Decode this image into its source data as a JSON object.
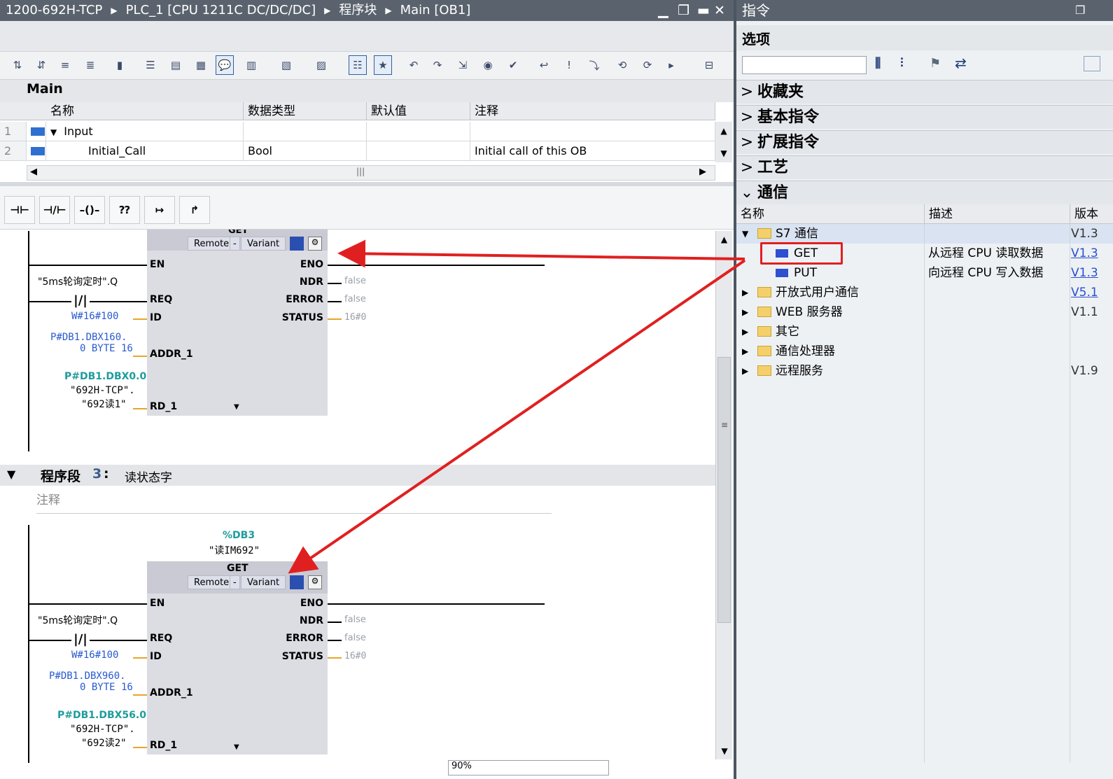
{
  "editor": {
    "breadcrumb": [
      "1200-692H-TCP",
      "PLC_1 [CPU 1211C DC/DC/DC]",
      "程序块",
      "Main [OB1]"
    ],
    "window_controls": [
      "minimize-icon",
      "restore-icon",
      "maximize-icon",
      "close-icon"
    ],
    "toolbar_icons": [
      "insert-network-icon",
      "delete-network-icon",
      "insert-row-icon",
      "add-row-icon",
      "display-favorites-icon",
      "open-all-networks-icon",
      "close-all-networks-icon",
      "show-absolute-operands-icon",
      "comments-toggle-icon",
      "operand-display-icon",
      "symbol-info-icon",
      "symbol-assign-icon",
      "monitor-table-icon",
      "favorites-icon",
      "jump-prev-icon",
      "jump-next-icon",
      "goto-icon",
      "watch-icon",
      "compile-icon",
      "call-icon",
      "breakpoint-icon",
      "step-icon",
      "monitor-icon",
      "download-icon",
      "more-icon",
      "interface-toggle-icon"
    ],
    "interface": {
      "section_title": "Main",
      "columns": [
        "名称",
        "数据类型",
        "默认值",
        "注释"
      ],
      "rows": [
        {
          "num": "1",
          "name": "Input",
          "type": "",
          "default": "",
          "comment": ""
        },
        {
          "num": "2",
          "name": "Initial_Call",
          "type": "Bool",
          "default": "",
          "comment": "Initial call of this OB"
        }
      ]
    },
    "ladder_buttons": [
      "no-contact-icon",
      "nc-contact-icon",
      "coil-icon",
      "empty-box-icon",
      "open-branch-icon",
      "close-branch-icon"
    ],
    "network2": {
      "block_title": "GET",
      "pills": [
        "Remote",
        "-",
        "Variant"
      ],
      "en": "EN",
      "eno": "ENO",
      "req_tag": "\"5ms轮询定时\".Q",
      "inputs": [
        "REQ",
        "ID",
        "ADDR_1",
        "RD_1"
      ],
      "outputs": [
        "NDR",
        "ERROR",
        "STATUS"
      ],
      "id_value": "W#16#100",
      "addr_value_l1": "P#DB1.DBX160.",
      "addr_value_l2": "0 BYTE 16",
      "rd_addr": "P#DB1.DBX0.0",
      "rd_tag_l1": "\"692H-TCP\".",
      "rd_tag_l2": "\"692读1\"",
      "ndr_val": "false",
      "error_val": "false",
      "status_val": "16#0"
    },
    "network3": {
      "title_prefix": "程序段",
      "number": "3",
      "colon": ":",
      "title": "读状态字",
      "comment_placeholder": "注释",
      "db": "%DB3",
      "db_name": "\"读IM692\"",
      "block_title": "GET",
      "pills": [
        "Remote",
        "-",
        "Variant"
      ],
      "en": "EN",
      "eno": "ENO",
      "req_tag": "\"5ms轮询定时\".Q",
      "inputs": [
        "REQ",
        "ID",
        "ADDR_1",
        "RD_1"
      ],
      "outputs": [
        "NDR",
        "ERROR",
        "STATUS"
      ],
      "id_value": "W#16#100",
      "addr_value_l1": "P#DB1.DBX960.",
      "addr_value_l2": "0 BYTE 16",
      "rd_addr": "P#DB1.DBX56.0",
      "rd_tag_l1": "\"692H-TCP\".",
      "rd_tag_l2": "\"692读2\"",
      "ndr_val": "false",
      "error_val": "false",
      "status_val": "16#0"
    },
    "zoom": "90%"
  },
  "instructions": {
    "title": "指令",
    "options_title": "选项",
    "search_value": "",
    "categories": [
      {
        "label": "收藏夹",
        "expanded": false
      },
      {
        "label": "基本指令",
        "expanded": false
      },
      {
        "label": "扩展指令",
        "expanded": false
      },
      {
        "label": "工艺",
        "expanded": false
      },
      {
        "label": "通信",
        "expanded": true
      }
    ],
    "columns": [
      "名称",
      "描述",
      "版本"
    ],
    "tree": [
      {
        "name": "S7 通信",
        "type": "folder",
        "expanded": true,
        "desc": "",
        "version": "V1.3"
      },
      {
        "name": "GET",
        "type": "block",
        "desc": "从远程 CPU 读取数据",
        "version": "V1.3"
      },
      {
        "name": "PUT",
        "type": "block",
        "desc": "向远程 CPU 写入数据",
        "version": "V1.3"
      },
      {
        "name": "开放式用户通信",
        "type": "folder",
        "desc": "",
        "version": "V5.1"
      },
      {
        "name": "WEB 服务器",
        "type": "folder",
        "desc": "",
        "version": "V1.1"
      },
      {
        "name": "其它",
        "type": "folder",
        "desc": "",
        "version": ""
      },
      {
        "name": "通信处理器",
        "type": "folder",
        "desc": "",
        "version": ""
      },
      {
        "name": "远程服务",
        "type": "folder",
        "desc": "",
        "version": "V1.9"
      }
    ],
    "highlight_color": "#e02020"
  }
}
